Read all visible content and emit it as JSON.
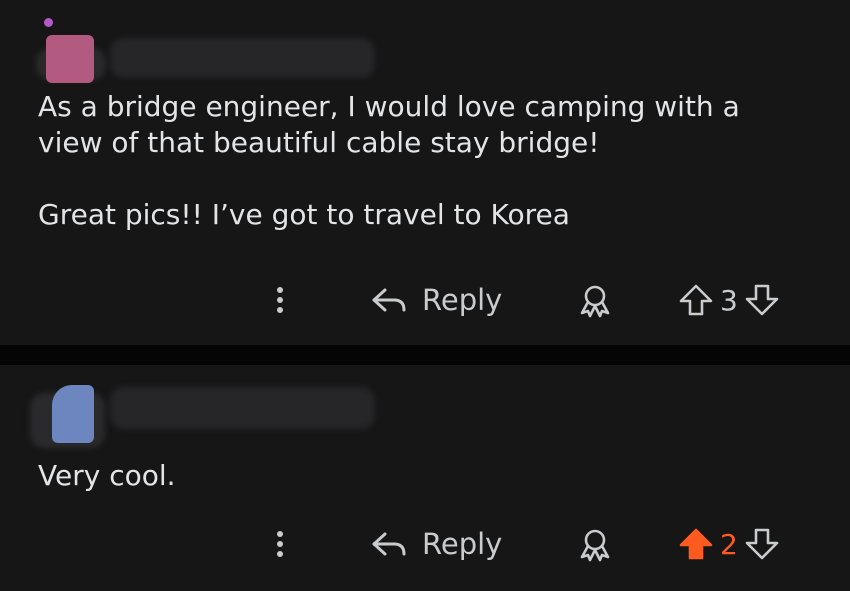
{
  "comments": [
    {
      "author_redacted": true,
      "avatar_color": "#b35a80",
      "body": "As a bridge engineer, I would love camping with a\nview of that beautiful cable stay bridge!\n\nGreat pics!! I’ve got to travel to Korea",
      "actions": {
        "reply_label": "Reply",
        "score": "3",
        "vote_state": "none"
      }
    },
    {
      "author_redacted": true,
      "avatar_color": "#6d86c0",
      "body": "Very cool.",
      "actions": {
        "reply_label": "Reply",
        "score": "2",
        "vote_state": "upvoted"
      }
    }
  ],
  "colors": {
    "background": "#161617",
    "separator": "#050505",
    "text": "#e3e4e6",
    "icon": "#c9cbcd",
    "upvote_active": "#ff5a1f"
  },
  "icons": [
    "more-vertical-icon",
    "reply-arrow-icon",
    "award-icon",
    "upvote-arrow-icon",
    "downvote-arrow-icon"
  ]
}
